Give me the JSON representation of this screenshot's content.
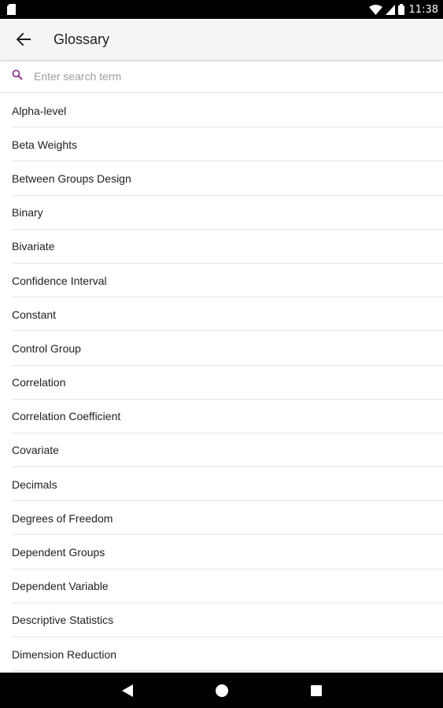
{
  "status_bar": {
    "time": "11:38",
    "icons": [
      "sim-card-icon",
      "wifi-icon",
      "cell-signal-icon",
      "battery-icon"
    ]
  },
  "app_bar": {
    "title": "Glossary",
    "back_icon": "arrow-back-icon"
  },
  "search": {
    "placeholder": "Enter search term",
    "value": "",
    "icon": "search-icon",
    "icon_color": "#8e3a8e"
  },
  "glossary": {
    "items": [
      "Alpha-level",
      "Beta Weights",
      "Between Groups Design",
      "Binary",
      "Bivariate",
      "Confidence Interval",
      "Constant",
      "Control Group",
      "Correlation",
      "Correlation Coefficient",
      "Covariate",
      "Decimals",
      "Degrees of Freedom",
      "Dependent Groups",
      "Dependent Variable",
      "Descriptive Statistics",
      "Dimension Reduction"
    ]
  },
  "nav_bar": {
    "buttons": [
      "back-triangle-icon",
      "home-circle-icon",
      "recents-square-icon"
    ]
  },
  "colors": {
    "app_bar_bg": "#f5f5f5",
    "accent": "#8e3a8e",
    "divider": "#e6e6e6",
    "text": "#212121",
    "placeholder": "#9e9e9e"
  }
}
